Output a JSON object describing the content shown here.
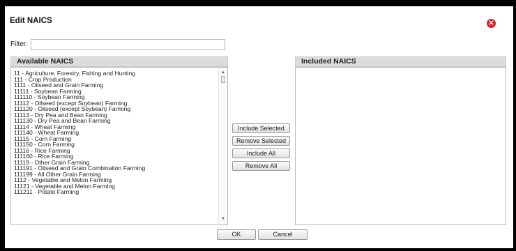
{
  "dialog": {
    "title": "Edit NAICS",
    "close_icon": "close-icon"
  },
  "filter": {
    "label": "Filter:",
    "value": "",
    "placeholder": ""
  },
  "available": {
    "header": "Available NAICS",
    "items": [
      "11 - Agriculture, Forestry, Fishing and Hunting",
      "111 - Crop Production",
      "1111 - Oilseed and Grain Farming",
      "11111 - Soybean Farming",
      "111110 - Soybean Farming",
      "11112 - Oilseed (except Soybean) Farming",
      "111120 - Oilseed (except Soybean) Farming",
      "11113 - Dry Pea and Bean Farming",
      "111130 - Dry Pea and Bean Farming",
      "11114 - Wheat Farming",
      "111140 - Wheat Farming",
      "11115 - Corn Farming",
      "111150 - Corn Farming",
      "11116 - Rice Farming",
      "111160 - Rice Farming",
      "11119 - Other Grain Farming",
      "111191 - Oilseed and Grain Combination Farming",
      "111199 - All Other Grain Farming",
      "1112 - Vegetable and Melon Farming",
      "11121 - Vegetable and Melon Farming",
      "111211 - Potato Farming"
    ]
  },
  "included": {
    "header": "Included NAICS",
    "items": []
  },
  "actions": {
    "include_selected": "Include Selected",
    "remove_selected": "Remove Selected",
    "include_all": "Include All",
    "remove_all": "Remove All"
  },
  "footer": {
    "ok": "OK",
    "cancel": "Cancel"
  },
  "colors": {
    "close_red": "#d9232b",
    "header_gray": "#dcdcdc"
  }
}
